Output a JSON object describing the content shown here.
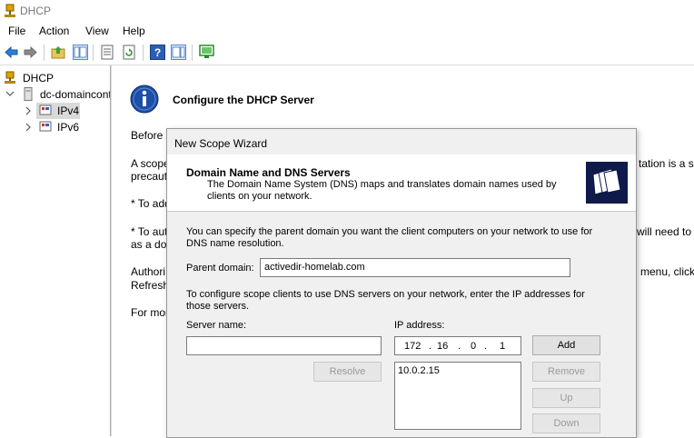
{
  "window": {
    "title": "DHCP"
  },
  "menu": {
    "items": [
      "File",
      "Action",
      "View",
      "Help"
    ]
  },
  "toolbar": {
    "icons": [
      "back-icon",
      "forward-icon",
      "up-folder-icon",
      "show-hide-tree-icon",
      "export-list-icon",
      "refresh-icon",
      "help-icon",
      "show-hide-action-pane-icon",
      "monitor-icon"
    ]
  },
  "tree": {
    "root": "DHCP",
    "server": "dc-domaincontroller",
    "ipv4": "IPv4",
    "ipv6": "IPv6"
  },
  "content": {
    "heading": "Configure the DHCP Server",
    "lines": [
      "Before a",
      "A scope",
      "precaut",
      "* To add",
      "* To aut",
      "as a dor",
      "Authori",
      "Refresh.",
      "For mor"
    ],
    "right_lines": [
      "tation is a sec",
      "will need to",
      "menu, click"
    ]
  },
  "wizard": {
    "title": "New Scope Wizard",
    "header_title": "Domain Name and DNS Servers",
    "header_desc": "The Domain Name System (DNS) maps and translates domain names used by clients on your network.",
    "intro": "You can specify the parent domain you want the client computers on your network to use for DNS name resolution.",
    "parent_domain_label": "Parent domain:",
    "parent_domain_value": "activedir-homelab.com",
    "configure_text": "To configure scope clients to use DNS servers on your network, enter the IP addresses for those servers.",
    "server_name_label": "Server name:",
    "server_name_value": "",
    "ip_label": "IP address:",
    "ip_octets": [
      "172",
      "16",
      "0",
      "1"
    ],
    "resolve_button": "Resolve",
    "add_button": "Add",
    "remove_button": "Remove",
    "up_button": "Up",
    "down_button": "Down",
    "dns_servers": [
      "10.0.2.15"
    ]
  }
}
